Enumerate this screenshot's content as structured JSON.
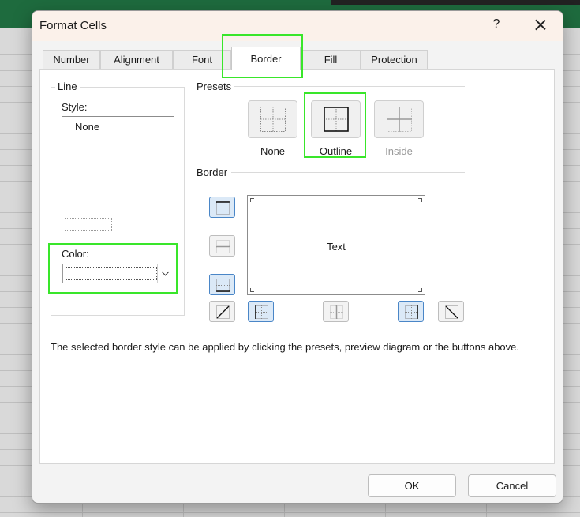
{
  "dialog": {
    "title": "Format Cells",
    "help": "?"
  },
  "tabs": [
    "Number",
    "Alignment",
    "Font",
    "Border",
    "Fill",
    "Protection"
  ],
  "active_tab": "Border",
  "line": {
    "group_label": "Line",
    "style_label": "Style:",
    "style_value": "None",
    "color_label": "Color:"
  },
  "presets": {
    "label": "Presets",
    "items": [
      "None",
      "Outline",
      "Inside"
    ]
  },
  "border": {
    "label": "Border",
    "preview_text": "Text"
  },
  "description": "The selected border style can be applied by clicking the presets, preview diagram or the buttons above.",
  "buttons": {
    "ok": "OK",
    "cancel": "Cancel"
  },
  "colors": {
    "highlight": "#39e62a",
    "toggle_on": "#dbe9f7",
    "excel_green": "#1e6b3e"
  },
  "highlighted": [
    "tab-border",
    "preset-outline-button",
    "color-dropdown"
  ]
}
